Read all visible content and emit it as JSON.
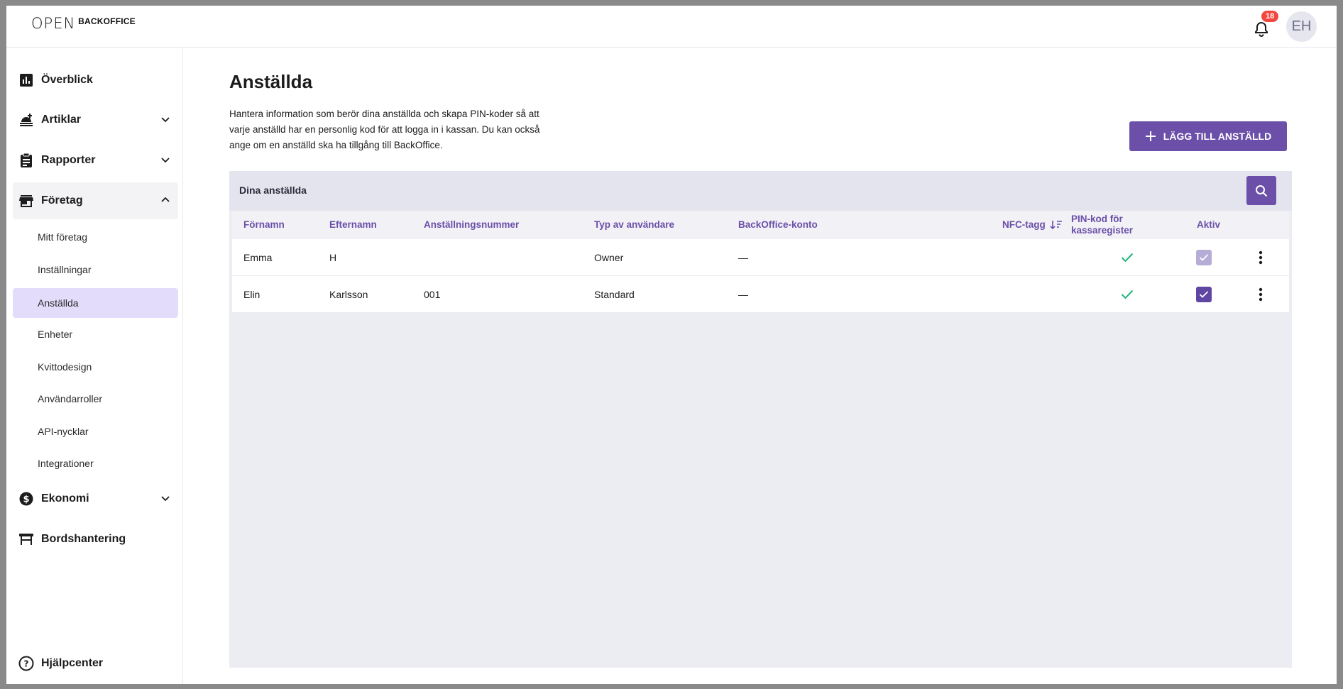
{
  "header": {
    "logo_mark": "OPEN",
    "logo_text": "BACKOFFICE",
    "notifications_count": "18",
    "avatar_initials": "EH"
  },
  "sidebar": {
    "items": [
      {
        "label": "Överblick",
        "icon": "chart-icon"
      },
      {
        "label": "Artiklar",
        "icon": "food-icon"
      },
      {
        "label": "Rapporter",
        "icon": "clipboard-icon"
      },
      {
        "label": "Företag",
        "icon": "store-icon"
      },
      {
        "label": "Ekonomi",
        "icon": "dollar-icon"
      },
      {
        "label": "Bordshantering",
        "icon": "table-icon"
      }
    ],
    "sub_items": [
      {
        "label": "Mitt företag"
      },
      {
        "label": "Inställningar"
      },
      {
        "label": "Anställda"
      },
      {
        "label": "Enheter"
      },
      {
        "label": "Kvittodesign"
      },
      {
        "label": "Användarroller"
      },
      {
        "label": "API-nycklar"
      },
      {
        "label": "Integrationer"
      }
    ],
    "help_label": "Hjälpcenter"
  },
  "main": {
    "title": "Anställda",
    "description": "Hantera information som berör dina anställda och skapa PIN-koder så att varje anställd har en personlig kod för att logga in i kassan. Du kan också ange om en anställd ska ha tillgång till BackOffice.",
    "add_button_label": "LÄGG TILL ANSTÄLLD",
    "panel_title": "Dina anställda",
    "columns": {
      "firstname": "Förnamn",
      "lastname": "Efternamn",
      "employee_number": "Anställningsnummer",
      "user_type": "Typ av användare",
      "backoffice": "BackOffice-konto",
      "nfc": "NFC-tagg",
      "pin_line1": "PIN-kod för",
      "pin_line2": "kassaregister",
      "active": "Aktiv"
    },
    "rows": [
      {
        "firstname": "Emma",
        "lastname": "H",
        "employee_number": "",
        "user_type": "Owner",
        "backoffice": "—",
        "pin": true,
        "active": true,
        "active_disabled": true
      },
      {
        "firstname": "Elin",
        "lastname": "Karlsson",
        "employee_number": "001",
        "user_type": "Standard",
        "backoffice": "—",
        "pin": true,
        "active": true,
        "active_disabled": false
      }
    ]
  },
  "colors": {
    "accent": "#6b4fa8",
    "active_nav": "#e4dcfb",
    "check_green": "#1fb47a",
    "badge_red": "#f2473f"
  }
}
